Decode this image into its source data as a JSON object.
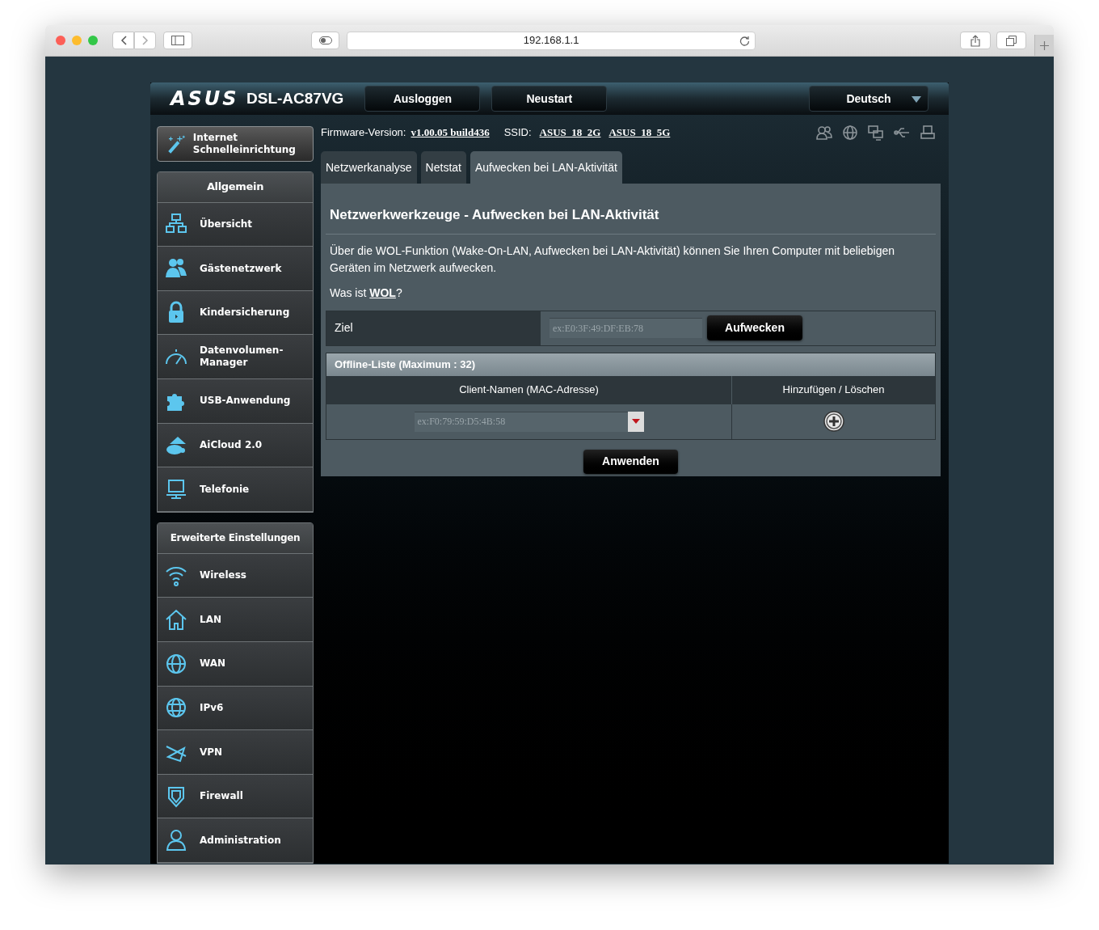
{
  "browser": {
    "url": "192.168.1.1"
  },
  "header": {
    "brand": "ASUS",
    "model": "DSL-AC87VG",
    "buttons": [
      "Ausloggen",
      "Neustart"
    ],
    "language": "Deutsch"
  },
  "info": {
    "firmware_label": "Firmware-Version:",
    "firmware": "v1.00.05 build436",
    "ssid_label": "SSID:",
    "ssids": [
      "ASUS_18_2G",
      "ASUS_18_5G"
    ]
  },
  "quick_setup": {
    "label": "Internet Schnelleinrichtung"
  },
  "sidebar": [
    {
      "title": "Allgemein",
      "items": [
        "Übersicht",
        "Gästenetzwerk",
        "Kindersicherung",
        "Datenvolumen-Manager",
        "USB-Anwendung",
        "AiCloud 2.0",
        "Telefonie"
      ]
    },
    {
      "title": "Erweiterte Einstellungen",
      "items": [
        "Wireless",
        "LAN",
        "WAN",
        "IPv6",
        "VPN",
        "Firewall",
        "Administration"
      ]
    }
  ],
  "tabs": [
    {
      "label": "Netzwerkanalyse",
      "selected": false
    },
    {
      "label": "Netstat",
      "selected": false
    },
    {
      "label": "Aufwecken bei LAN-Aktivität",
      "selected": true
    }
  ],
  "page": {
    "title": "Netzwerkwerkzeuge - Aufwecken bei LAN-Aktivität",
    "description": "Über die WOL-Funktion (Wake-On-LAN, Aufwecken bei LAN-Aktivität) können Sie Ihren Computer mit beliebigen Geräten im Netzwerk aufwecken.",
    "help": {
      "prefix": "Was ist ",
      "link": "WOL",
      "suffix": "?"
    },
    "target": {
      "label": "Ziel",
      "placeholder": "ex:E0:3F:49:DF:EB:78",
      "button": "Aufwecken"
    },
    "offline_list": {
      "title": "Offline-Liste (Maximum : 32)",
      "columns": [
        "Client-Namen (MAC-Adresse)",
        "Hinzufügen / Löschen"
      ],
      "placeholder": "ex:F0:79:59:D5:4B:58"
    },
    "apply": "Anwenden"
  }
}
